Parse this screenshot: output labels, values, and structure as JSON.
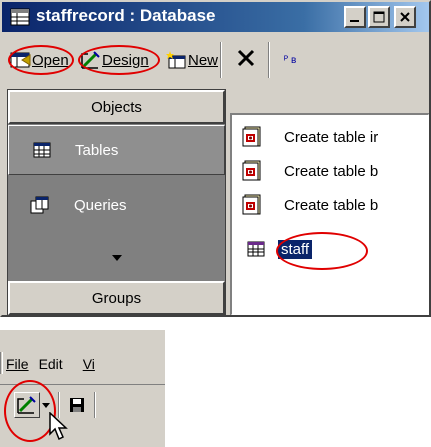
{
  "window": {
    "title": "staffrecord : Database",
    "caption_buttons": [
      "minimize-icon",
      "maximize-icon",
      "close-icon"
    ]
  },
  "toolbar": {
    "open_label": "Open",
    "design_label": "Design",
    "new_label": "New",
    "delete_icon": "delete-icon",
    "truncated_label": "ᴾ ʙ"
  },
  "objects_bar": {
    "objects_label": "Objects",
    "items": [
      {
        "label": "Tables",
        "icon": "table-icon",
        "selected": true
      },
      {
        "label": "Queries",
        "icon": "query-icon",
        "selected": false
      }
    ],
    "groups_label": "Groups"
  },
  "object_list": [
    {
      "label": "Create table ir",
      "icon": "wizard-icon"
    },
    {
      "label": "Create table b",
      "icon": "wizard-icon"
    },
    {
      "label": "Create table b",
      "icon": "wizard-icon"
    },
    {
      "label": "staff",
      "icon": "table-icon",
      "selected": true
    }
  ],
  "lower_window": {
    "menu": [
      "File",
      "Edit",
      "Vi"
    ],
    "buttons": [
      "design-view-icon",
      "dropdown-arrow-icon",
      "save-icon"
    ]
  },
  "colors": {
    "titlebar_start": "#0a246a",
    "titlebar_end": "#a6caf0",
    "highlight_ellipse": "#e00000",
    "face": "#d4d0c8",
    "selection": "#0a246a"
  }
}
